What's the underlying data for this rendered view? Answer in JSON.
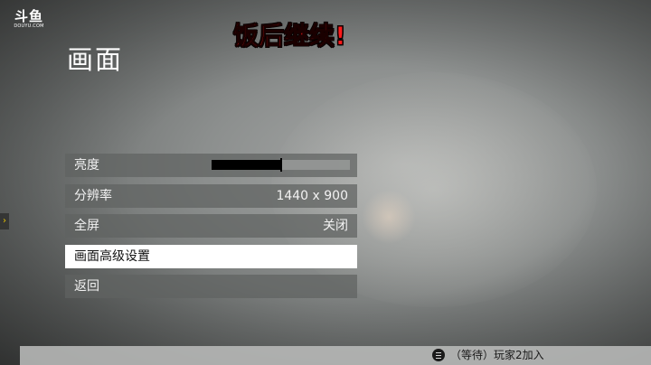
{
  "watermark": {
    "logo_main": "斗鱼",
    "logo_sub": "DOUYU.COM"
  },
  "overlay_text": "饭后继续!",
  "page_title": "画面",
  "menu": {
    "items": [
      {
        "label": "亮度",
        "type": "slider",
        "value": 0.5
      },
      {
        "label": "分辨率",
        "type": "value",
        "value": "1440 x 900"
      },
      {
        "label": "全屏",
        "type": "value",
        "value": "关闭"
      },
      {
        "label": "画面高级设置",
        "type": "link",
        "selected": true
      },
      {
        "label": "返回",
        "type": "link"
      }
    ]
  },
  "side_arrow": "›",
  "footer": {
    "icon": "menu-button-icon",
    "text": "（等待）玩家2加入"
  },
  "colors": {
    "overlay_text": "#ff1a1a",
    "selected_bg": "#ffffff",
    "item_bg": "#5f6261",
    "slider_fill": "#000000"
  }
}
